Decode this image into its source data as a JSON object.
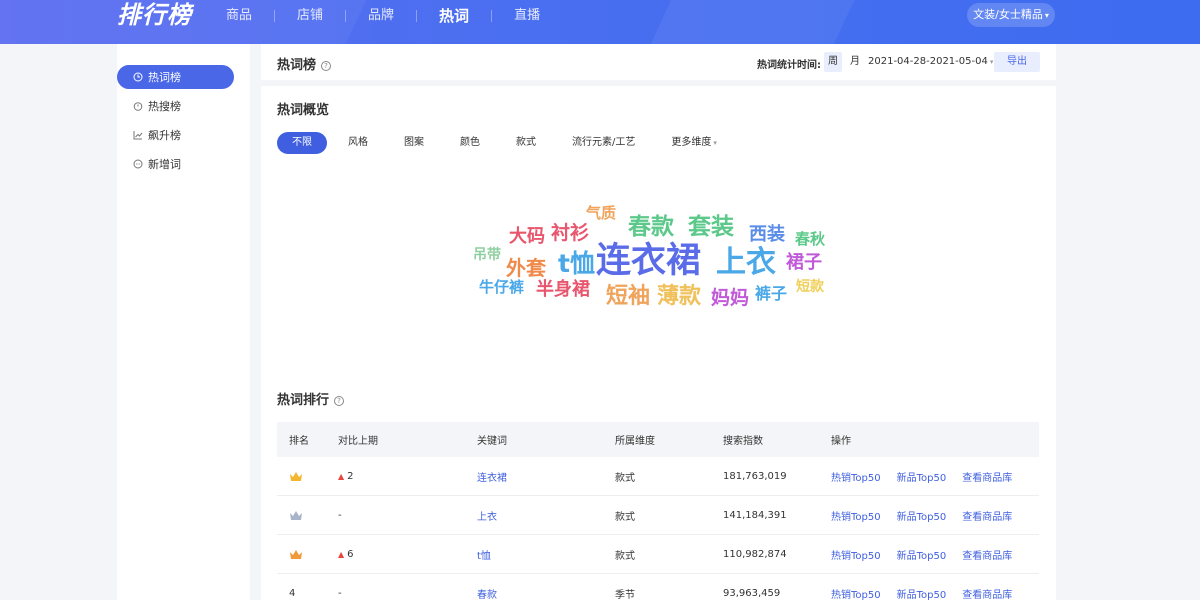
{
  "topbar": {
    "logo": "排行榜",
    "nav": [
      "商品",
      "店铺",
      "品牌",
      "热词",
      "直播"
    ],
    "active_nav": "热词",
    "category": "文装/女士精品"
  },
  "sidebar": {
    "items": [
      {
        "label": "热词榜",
        "icon": "clock-icon",
        "active": true
      },
      {
        "label": "热搜榜",
        "icon": "timer-icon",
        "active": false
      },
      {
        "label": "飙升榜",
        "icon": "trend-icon",
        "active": false
      },
      {
        "label": "新增词",
        "icon": "chat-icon",
        "active": false
      }
    ]
  },
  "header": {
    "title": "热词榜",
    "stat_label": "热词统计时间:",
    "week": "周",
    "month": "月",
    "date_range": "2021-04-28-2021-05-04",
    "export": "导出"
  },
  "overview": {
    "title": "热词概览",
    "filters": [
      "不限",
      "风格",
      "图案",
      "颜色",
      "款式",
      "流行元素/工艺",
      "更多维度"
    ],
    "words": [
      {
        "text": "气质",
        "color": "#f0a35a"
      },
      {
        "text": "大码",
        "color": "#e8566e"
      },
      {
        "text": "衬衫",
        "color": "#e8566e"
      },
      {
        "text": "春款",
        "color": "#5cc98a"
      },
      {
        "text": "套装",
        "color": "#5cc98a"
      },
      {
        "text": "西装",
        "color": "#5a8de8"
      },
      {
        "text": "春秋",
        "color": "#5cc98a"
      },
      {
        "text": "吊带",
        "color": "#8fd0a0"
      },
      {
        "text": "外套",
        "color": "#f08a4a"
      },
      {
        "text": "t恤",
        "color": "#4aa8e8"
      },
      {
        "text": "连衣裙",
        "color": "#5a6ce8"
      },
      {
        "text": "上衣",
        "color": "#4aa8e8"
      },
      {
        "text": "裙子",
        "color": "#c05ad8"
      },
      {
        "text": "牛仔裤",
        "color": "#4aa8e8"
      },
      {
        "text": "半身裙",
        "color": "#e8566e"
      },
      {
        "text": "短袖",
        "color": "#f0a35a"
      },
      {
        "text": "薄款",
        "color": "#f0c05a"
      },
      {
        "text": "妈妈",
        "color": "#c05ad8"
      },
      {
        "text": "裤子",
        "color": "#4aa8e8"
      },
      {
        "text": "短款",
        "color": "#f0d05a"
      }
    ]
  },
  "ranking": {
    "title": "热词排行",
    "columns": [
      "排名",
      "对比上期",
      "关键词",
      "所属维度",
      "搜索指数",
      "操作"
    ],
    "ops": [
      "热销Top50",
      "新品Top50",
      "查看商品库"
    ],
    "rows": [
      {
        "rank": "",
        "rank_badge": "gold",
        "compare": "2",
        "compare_up": true,
        "keyword": "连衣裙",
        "dimension": "款式",
        "index": "181,763,019"
      },
      {
        "rank": "",
        "rank_badge": "silver",
        "compare": "-",
        "compare_up": false,
        "keyword": "上衣",
        "dimension": "款式",
        "index": "141,184,391"
      },
      {
        "rank": "",
        "rank_badge": "bronze",
        "compare": "6",
        "compare_up": true,
        "keyword": "t恤",
        "dimension": "款式",
        "index": "110,982,874"
      },
      {
        "rank": "4",
        "rank_badge": "",
        "compare": "-",
        "compare_up": false,
        "keyword": "春款",
        "dimension": "季节",
        "index": "93,963,459"
      }
    ]
  }
}
